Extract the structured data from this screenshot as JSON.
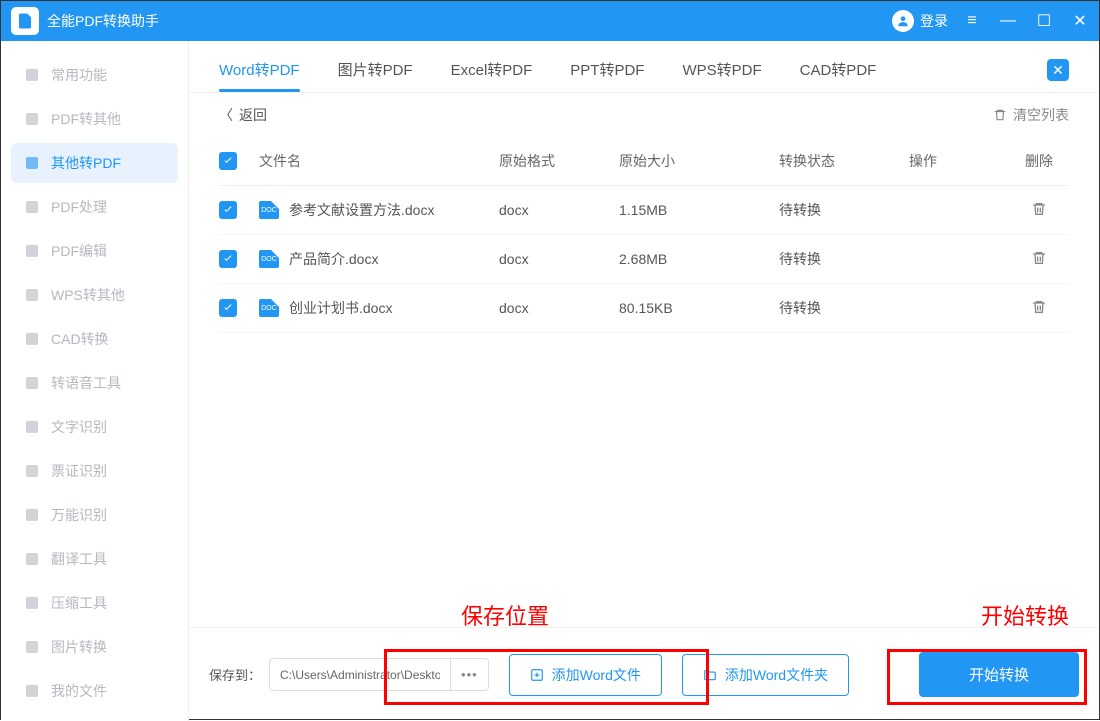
{
  "titlebar": {
    "title": "全能PDF转换助手",
    "login_label": "登录"
  },
  "sidebar": {
    "items": [
      {
        "label": "常用功能"
      },
      {
        "label": "PDF转其他"
      },
      {
        "label": "其他转PDF"
      },
      {
        "label": "PDF处理"
      },
      {
        "label": "PDF编辑"
      },
      {
        "label": "WPS转其他"
      },
      {
        "label": "CAD转换"
      },
      {
        "label": "转语音工具"
      },
      {
        "label": "文字识别"
      },
      {
        "label": "票证识别"
      },
      {
        "label": "万能识别"
      },
      {
        "label": "翻译工具"
      },
      {
        "label": "压缩工具"
      },
      {
        "label": "图片转换"
      },
      {
        "label": "我的文件"
      }
    ],
    "active_index": 2
  },
  "tabs": {
    "items": [
      {
        "label": "Word转PDF"
      },
      {
        "label": "图片转PDF"
      },
      {
        "label": "Excel转PDF"
      },
      {
        "label": "PPT转PDF"
      },
      {
        "label": "WPS转PDF"
      },
      {
        "label": "CAD转PDF"
      }
    ],
    "active_index": 0
  },
  "toolbar": {
    "back_label": "返回",
    "clear_label": "清空列表"
  },
  "table": {
    "headers": {
      "filename": "文件名",
      "format": "原始格式",
      "size": "原始大小",
      "status": "转换状态",
      "action": "操作",
      "delete": "删除"
    },
    "rows": [
      {
        "name": "参考文献设置方法.docx",
        "format": "docx",
        "size": "1.15MB",
        "status": "待转换"
      },
      {
        "name": "产品简介.docx",
        "format": "docx",
        "size": "2.68MB",
        "status": "待转换"
      },
      {
        "name": "创业计划书.docx",
        "format": "docx",
        "size": "80.15KB",
        "status": "待转换"
      }
    ]
  },
  "bottom": {
    "save_to_label": "保存到：",
    "save_path": "C:\\Users\\Administrator\\Desktop",
    "add_file_label": "添加Word文件",
    "add_folder_label": "添加Word文件夹",
    "start_label": "开始转换"
  },
  "annotations": {
    "save_location": "保存位置",
    "start_convert": "开始转换"
  }
}
